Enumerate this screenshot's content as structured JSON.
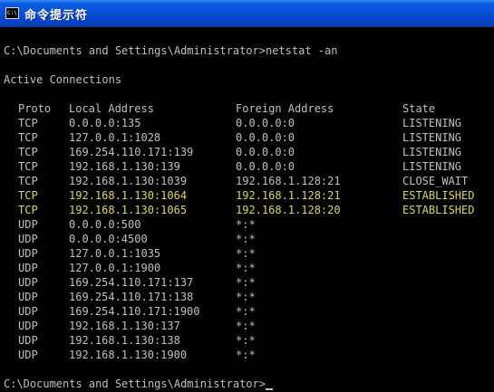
{
  "window": {
    "title": "命令提示符",
    "icon_text": "C:\\"
  },
  "console": {
    "command_line": "C:\\Documents and Settings\\Administrator>netstat -an",
    "heading": "Active Connections",
    "columns": {
      "proto": "Proto",
      "local": "Local Address",
      "foreign": "Foreign Address",
      "state": "State"
    },
    "rows": [
      {
        "proto": "TCP",
        "local": "0.0.0.0:135",
        "foreign": "0.0.0.0:0",
        "state": "LISTENING"
      },
      {
        "proto": "TCP",
        "local": "127.0.0.1:1028",
        "foreign": "0.0.0.0:0",
        "state": "LISTENING"
      },
      {
        "proto": "TCP",
        "local": "169.254.110.171:139",
        "foreign": "0.0.0.0:0",
        "state": "LISTENING"
      },
      {
        "proto": "TCP",
        "local": "192.168.1.130:139",
        "foreign": "0.0.0.0:0",
        "state": "LISTENING"
      },
      {
        "proto": "TCP",
        "local": "192.168.1.130:1039",
        "foreign": "192.168.1.128:21",
        "state": "CLOSE_WAIT"
      },
      {
        "proto": "TCP",
        "local": "192.168.1.130:1064",
        "foreign": "192.168.1.128:21",
        "state": "ESTABLISHED"
      },
      {
        "proto": "TCP",
        "local": "192.168.1.130:1065",
        "foreign": "192.168.1.128:20",
        "state": "ESTABLISHED"
      },
      {
        "proto": "UDP",
        "local": "0.0.0.0:500",
        "foreign": "*:*",
        "state": ""
      },
      {
        "proto": "UDP",
        "local": "0.0.0.0:4500",
        "foreign": "*:*",
        "state": ""
      },
      {
        "proto": "UDP",
        "local": "127.0.0.1:1035",
        "foreign": "*:*",
        "state": ""
      },
      {
        "proto": "UDP",
        "local": "127.0.0.1:1900",
        "foreign": "*:*",
        "state": ""
      },
      {
        "proto": "UDP",
        "local": "169.254.110.171:137",
        "foreign": "*:*",
        "state": ""
      },
      {
        "proto": "UDP",
        "local": "169.254.110.171:138",
        "foreign": "*:*",
        "state": ""
      },
      {
        "proto": "UDP",
        "local": "169.254.110.171:1900",
        "foreign": "*:*",
        "state": ""
      },
      {
        "proto": "UDP",
        "local": "192.168.1.130:137",
        "foreign": "*:*",
        "state": ""
      },
      {
        "proto": "UDP",
        "local": "192.168.1.130:138",
        "foreign": "*:*",
        "state": ""
      },
      {
        "proto": "UDP",
        "local": "192.168.1.130:1900",
        "foreign": "*:*",
        "state": ""
      }
    ],
    "prompt": "C:\\Documents and Settings\\Administrator>"
  },
  "colors": {
    "console_background": "#000000",
    "console_text": "#c0c0c0",
    "highlight_text": "#d8d860",
    "titlebar_blue": "#0450d6"
  }
}
